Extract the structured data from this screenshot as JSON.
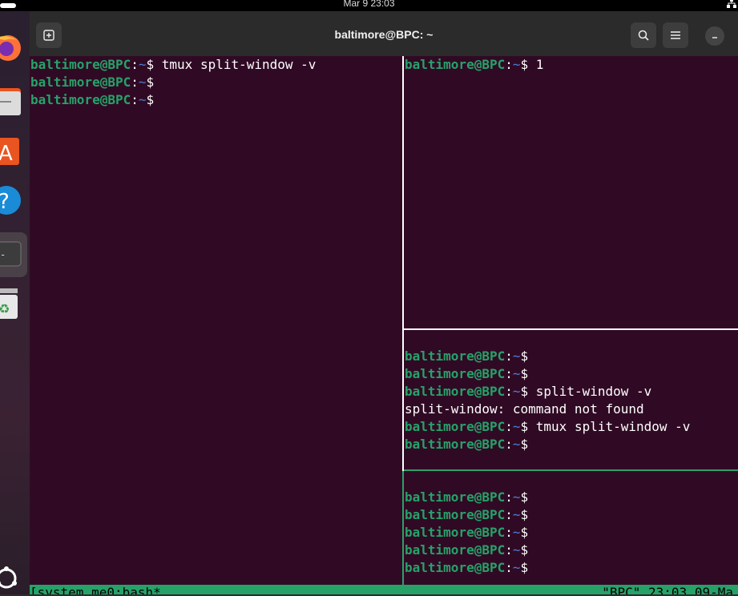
{
  "topbar": {
    "clock": "Mar 9  23:03"
  },
  "window": {
    "title": "baltimore@BPC: ~"
  },
  "prompt": {
    "user": "baltimore@BPC",
    "sep": ":",
    "path": "~",
    "dollar": "$ "
  },
  "panes": {
    "left": [
      {
        "cmd": "tmux split-window -v"
      },
      {
        "cmd": ""
      },
      {
        "cmd": ""
      }
    ],
    "top_right": [
      {
        "cmd": "1"
      }
    ],
    "middle_right": [
      {
        "blank": true
      },
      {
        "cmd": ""
      },
      {
        "cmd": ""
      },
      {
        "cmd": "split-window -v"
      },
      {
        "text": "split-window: command not found"
      },
      {
        "cmd": "tmux split-window -v"
      },
      {
        "cmd": ""
      }
    ],
    "bottom_right": [
      {
        "blank": true
      },
      {
        "cmd": ""
      },
      {
        "cmd": ""
      },
      {
        "cmd": ""
      },
      {
        "cmd": ""
      },
      {
        "cmd": ""
      }
    ]
  },
  "statusbar": {
    "left": "[system_me0:bash*",
    "right": "\"BPC\" 23:03 09-Ma"
  },
  "colors": {
    "terminal_bg": "#300a24",
    "prompt_user": "#26a269",
    "status_bg": "#26a269"
  }
}
